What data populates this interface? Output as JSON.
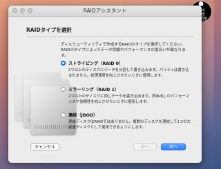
{
  "window": {
    "title": "RAIDアシスタント"
  },
  "page": {
    "heading": "RAIDタイプを選択",
    "description": "ディスクユーティリティで作成するRAIDのタイプを選択してください。RAIDのタイプによってデータ保護やパフォーマンスの度合いが異なります。"
  },
  "options": [
    {
      "label": "ストライピング（RAID 0）",
      "selected": true,
      "description": "2つ以上のディスクにデータを分割して書き込みます。パリティは書き込まれません。処理速度を向上させたいときに使用します。"
    },
    {
      "label": "ミラーリング（RAID 1）",
      "selected": false,
      "description": "2つ以上のディスクに同じデータを書き込みます。読み出しのパフォーマンスや信頼性を向上させたいときに使用します。"
    },
    {
      "label": "連結（JBOD）",
      "selected": false,
      "description": "連結ディスクはRAIDではありません。複数のディスクを連結して1つの大容量ディスクとして使用できるようにします。"
    }
  ],
  "buttons": {
    "cancel": "キャンセル",
    "back": "前へ",
    "next": "次へ"
  },
  "badge": {
    "line1": "Mac",
    "line2": "お宝",
    "line3": "鑑定団"
  },
  "colors": {
    "accent": "#2f7df6"
  }
}
